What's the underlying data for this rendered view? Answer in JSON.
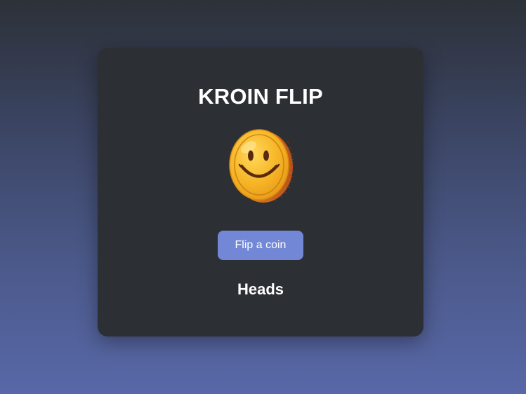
{
  "app": {
    "title": "KROIN FLIP"
  },
  "coin": {
    "icon": "smiley-coin-icon",
    "face_color": "#f7b82a",
    "rim_color": "#c9661a"
  },
  "controls": {
    "flip_label": "Flip a coin",
    "accent": "#7287d6"
  },
  "result": {
    "text": "Heads"
  }
}
